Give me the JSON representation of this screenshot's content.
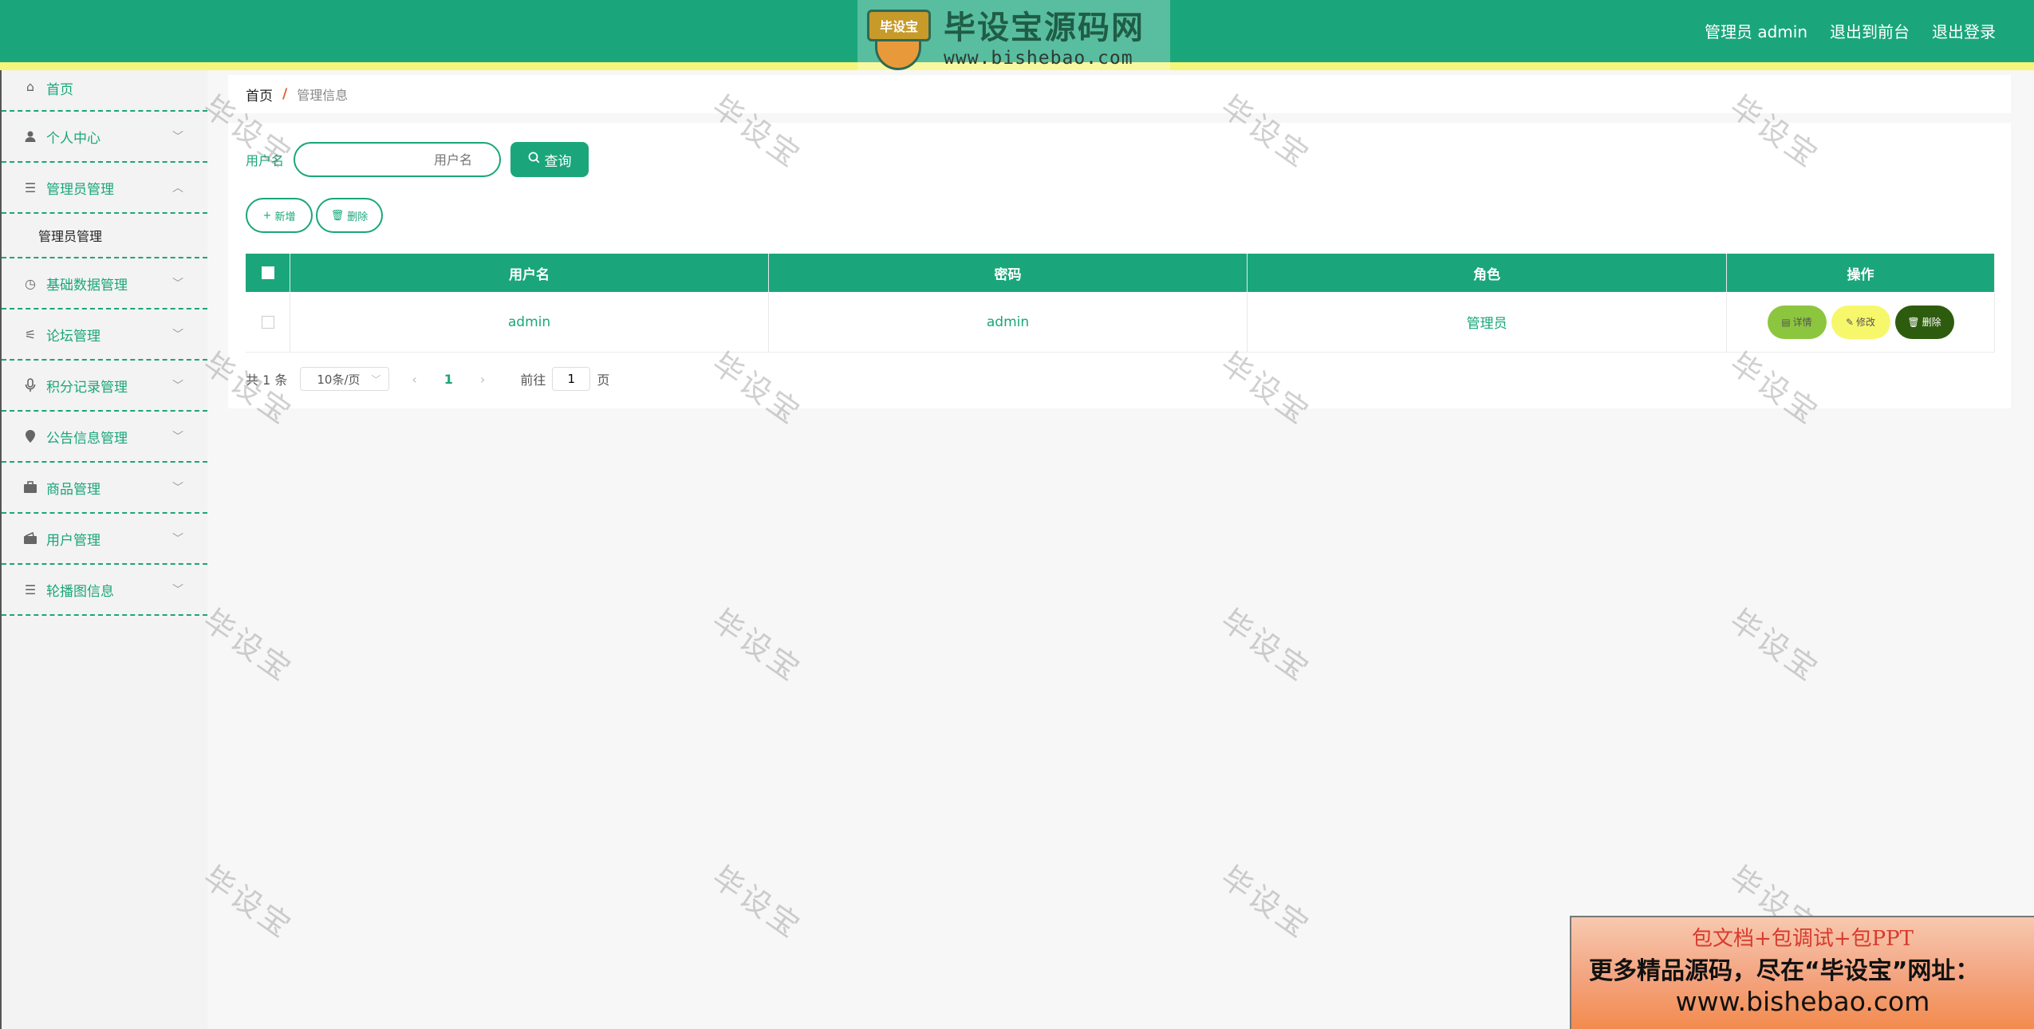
{
  "header": {
    "logo_badge": "毕设宝",
    "logo_title": "毕设宝源码网",
    "logo_url": "www.bishebao.com",
    "user_label": "管理员 admin",
    "to_front": "退出到前台",
    "logout": "退出登录"
  },
  "sidebar": {
    "items": [
      {
        "label": "首页",
        "icon": "home-icon"
      },
      {
        "label": "个人中心",
        "icon": "user-icon"
      },
      {
        "label": "管理员管理",
        "icon": "list-icon"
      },
      {
        "label": "基础数据管理",
        "icon": "clock-icon"
      },
      {
        "label": "论坛管理",
        "icon": "sliders-icon"
      },
      {
        "label": "积分记录管理",
        "icon": "microphone-icon"
      },
      {
        "label": "公告信息管理",
        "icon": "location-icon"
      },
      {
        "label": "商品管理",
        "icon": "briefcase-icon"
      },
      {
        "label": "用户管理",
        "icon": "wallet-icon"
      },
      {
        "label": "轮播图信息",
        "icon": "list-icon"
      }
    ],
    "submenu_active": "管理员管理"
  },
  "breadcrumb": {
    "home": "首页",
    "separator": "/",
    "current": "管理信息"
  },
  "search": {
    "label": "用户名",
    "placeholder": "用户名",
    "button": "查询"
  },
  "actions": {
    "add": "新增",
    "delete": "删除"
  },
  "table": {
    "columns": [
      "用户名",
      "密码",
      "角色",
      "操作"
    ],
    "rows": [
      {
        "username": "admin",
        "password": "admin",
        "role": "管理员"
      }
    ],
    "row_actions": {
      "detail": "详情",
      "edit": "修改",
      "delete": "删除"
    }
  },
  "pagination": {
    "total_text": "共 1 条",
    "page_size": "10条/页",
    "current_page": "1",
    "goto_label": "前往",
    "goto_value": "1",
    "page_suffix": "页"
  },
  "watermark": "毕设宝",
  "ad": {
    "line1": "包文档+包调试+包PPT",
    "line2": "更多精品源码，尽在“毕设宝”网址：",
    "line3": "www.bishebao.com"
  },
  "colors": {
    "primary": "#1aa67a",
    "accent_yellow": "#f5f57a",
    "detail": "#8cc63f",
    "edit": "#f7f76b",
    "delete": "#2e5c0e"
  }
}
